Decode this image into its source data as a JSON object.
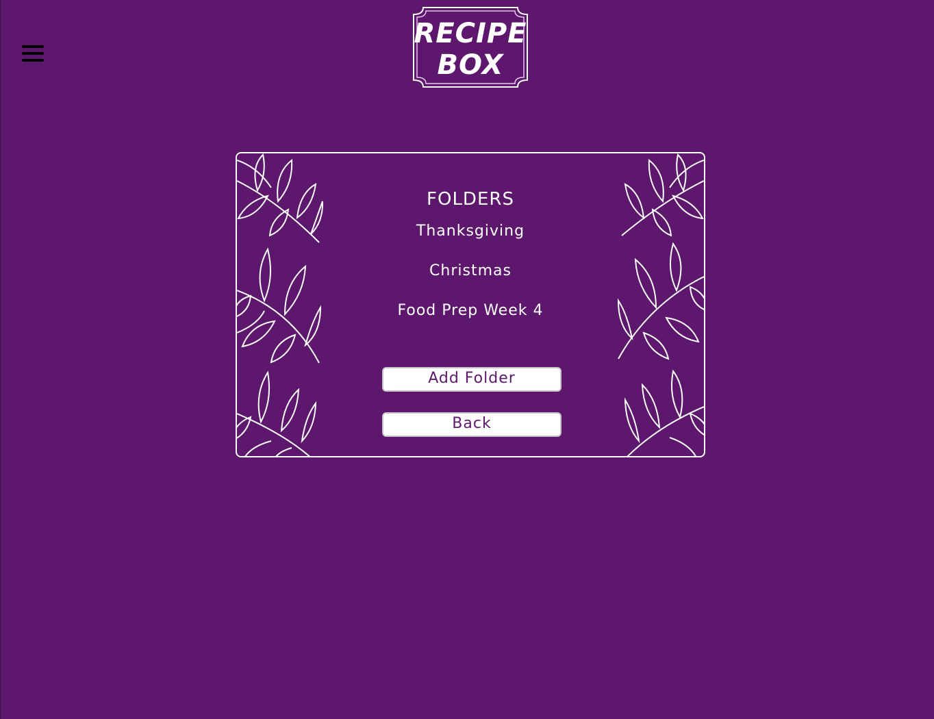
{
  "header": {
    "menu_icon": "hamburger-menu-icon",
    "logo_line1": "RECIPE",
    "logo_line2": "BOX"
  },
  "folders": {
    "title": "FOLDERS",
    "items": [
      {
        "label": "Thanksgiving"
      },
      {
        "label": "Christmas"
      },
      {
        "label": "Food Prep Week 4"
      }
    ],
    "add_button_label": "Add Folder",
    "back_button_label": "Back"
  },
  "colors": {
    "background": "#5d176c",
    "foreground": "#ffffff",
    "button_text": "#5d176c"
  }
}
